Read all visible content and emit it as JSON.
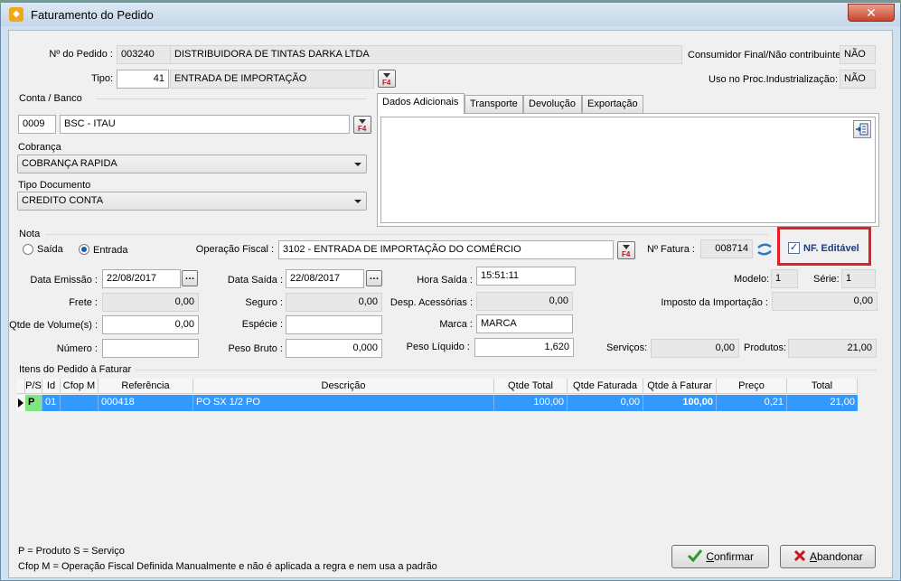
{
  "window": {
    "title": "Faturamento do Pedido",
    "app_icon": "app-diamond-icon",
    "close_glyph": "✕"
  },
  "pedido": {
    "label": "Nº do Pedido :",
    "number": "003240",
    "client": "DISTRIBUIDORA DE TINTAS DARKA LTDA"
  },
  "consumidor": {
    "label": "Consumidor Final/Não contribuinte:",
    "value": "NÃO"
  },
  "tipo": {
    "label": "Tipo:",
    "code": "41",
    "desc": "ENTRADA DE IMPORTAÇÃO"
  },
  "uso": {
    "label": "Uso no Proc.Industrialização:",
    "value": "NÃO"
  },
  "conta": {
    "group_label": "Conta / Banco",
    "code": "0009",
    "name": "BSC - ITAU"
  },
  "cobranca": {
    "label": "Cobrança",
    "value": "COBRANÇA RAPIDA"
  },
  "tipo_documento": {
    "label": "Tipo Documento",
    "value": "CREDITO CONTA"
  },
  "tabs": [
    {
      "label": "Dados Adicionais"
    },
    {
      "label": "Transporte"
    },
    {
      "label": "Devolução"
    },
    {
      "label": "Exportação"
    }
  ],
  "f4_text": "F4",
  "nota": {
    "group_label": "Nota",
    "saida_label": "Saída",
    "entrada_label": "Entrada",
    "operacao_label": "Operação Fiscal :",
    "operacao_value": "3102 - ENTRADA DE IMPORTAÇÃO DO COMÉRCIO",
    "fatura_label": "Nº Fatura :",
    "fatura_value": "008714",
    "nf_editavel_label": "NF. Editável",
    "data_emissao_label": "Data Emissão :",
    "data_emissao": "22/08/2017",
    "data_saida_label": "Data Saída :",
    "data_saida": "22/08/2017",
    "hora_saida_label": "Hora Saída :",
    "hora_saida": "15:51:11",
    "modelo_label": "Modelo:",
    "modelo": "1",
    "serie_label": "Série:",
    "serie": "1",
    "frete_label": "Frete :",
    "frete": "0,00",
    "seguro_label": "Seguro :",
    "seguro": "0,00",
    "desp_label": "Desp. Acessórias :",
    "desp": "0,00",
    "imposto_label": "Imposto da Importação :",
    "imposto": "0,00",
    "volumes_label": "Qtde de Volume(s) :",
    "volumes": "0,00",
    "especie_label": "Espécie :",
    "especie": "",
    "marca_label": "Marca :",
    "marca": "MARCA",
    "numero_label": "Número :",
    "numero": "",
    "peso_bruto_label": "Peso Bruto :",
    "peso_bruto": "0,000",
    "peso_liquido_label": "Peso Líquido :",
    "peso_liquido": "1,620",
    "servicos_label": "Serviços:",
    "servicos": "0,00",
    "produtos_label": "Produtos:",
    "produtos": "21,00"
  },
  "itens": {
    "group_label": "Itens do Pedido à Faturar",
    "headers": [
      "P/S",
      "Id",
      "Cfop M",
      "Referência",
      "Descrição",
      "Qtde Total",
      "Qtde Faturada",
      "Qtde à Faturar",
      "Preço",
      "Total"
    ],
    "rows": [
      {
        "ps": "P",
        "id": "01",
        "cfop": "",
        "ref": "000418",
        "desc": "PO SX 1/2 PO",
        "qtde_total": "100,00",
        "qtde_faturada": "0,00",
        "qtde_a_faturar": "100,00",
        "preco": "0,21",
        "total": "21,00"
      }
    ]
  },
  "legend": {
    "line1": "P = Produto S = Serviço",
    "line2": "Cfop M = Operação Fiscal Definida Manualmente e não é aplicada a regra e nem usa a padrão"
  },
  "buttons": {
    "confirm_first": "C",
    "confirm_rest": "onfirmar",
    "cancel_first": "A",
    "cancel_rest": "bandonar"
  },
  "colors": {
    "selection": "#3399ff",
    "highlight": "#e51e25",
    "ps_cell": "#7fe57f"
  }
}
